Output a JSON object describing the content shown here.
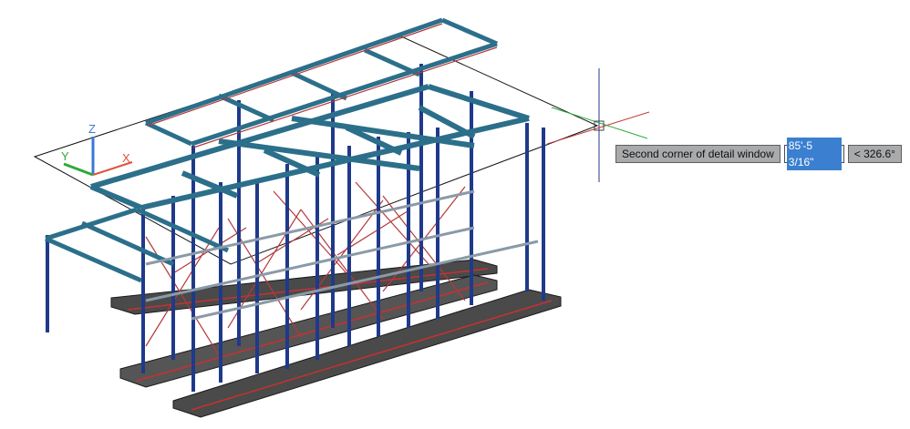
{
  "prompt": {
    "label": "Second corner of detail window",
    "input_value": "85'-5 3/16\"",
    "angle": "< 326.6°"
  },
  "ucs": {
    "x_label": "X",
    "y_label": "Y",
    "z_label": "Z",
    "x_color": "#e0523c",
    "y_color": "#2eaa3a",
    "z_color": "#3a78d8"
  },
  "colors": {
    "column": "#1f3a8a",
    "beam": "#2c6f8a",
    "brace": "#b43a3a",
    "footing": "#3a3a3a",
    "crosshair_v": "#1f3a8a",
    "crosshair_h": "#c23b3b"
  }
}
